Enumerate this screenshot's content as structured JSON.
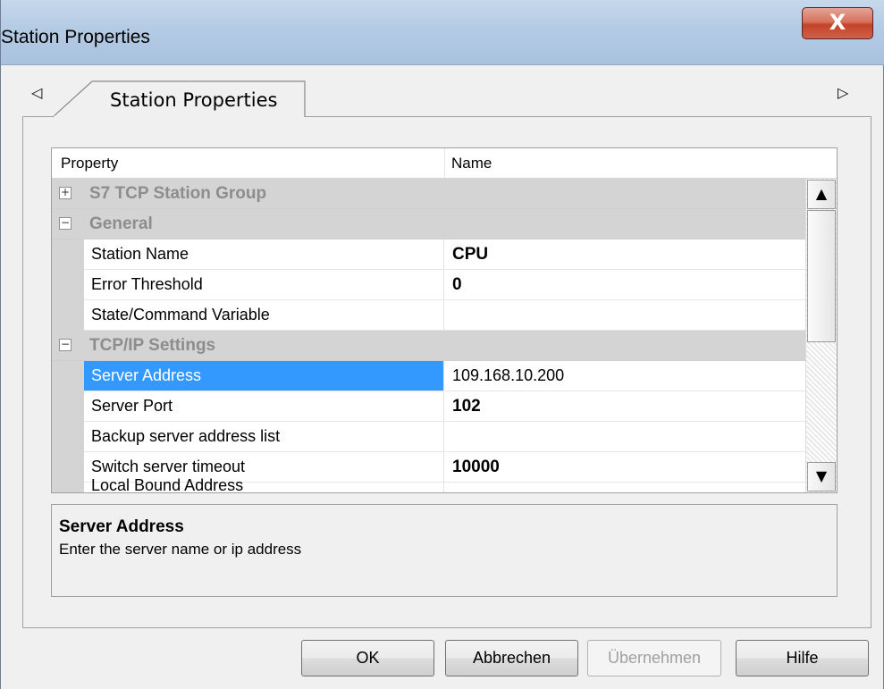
{
  "window": {
    "title": "Station Properties",
    "close_glyph": "X"
  },
  "tabs": {
    "prev_arrow": "◁",
    "next_arrow": "▷",
    "items": [
      {
        "label": "Station Properties",
        "active": true
      }
    ]
  },
  "grid": {
    "header": {
      "property": "Property",
      "name": "Name"
    },
    "rows": [
      {
        "type": "category",
        "expander": "+",
        "label": "S7 TCP Station Group"
      },
      {
        "type": "category",
        "expander": "−",
        "label": "General"
      },
      {
        "type": "property",
        "name": "Station Name",
        "value": "CPU",
        "bold": true
      },
      {
        "type": "property",
        "name": "Error Threshold",
        "value": "0",
        "bold": true
      },
      {
        "type": "property",
        "name": "State/Command Variable",
        "value": ""
      },
      {
        "type": "category",
        "expander": "−",
        "label": "TCP/IP Settings"
      },
      {
        "type": "property",
        "name": "Server Address",
        "value": "109.168.10.200",
        "selected": true
      },
      {
        "type": "property",
        "name": "Server Port",
        "value": "102",
        "bold": true
      },
      {
        "type": "property",
        "name": "Backup server address list",
        "value": ""
      },
      {
        "type": "property",
        "name": "Switch server timeout",
        "value": "10000",
        "bold": true
      },
      {
        "type": "property",
        "name": "Local Bound Address",
        "value": ""
      }
    ],
    "scroll_up": "▲",
    "scroll_down": "▼"
  },
  "description": {
    "title": "Server Address",
    "text": "Enter the server name or ip address"
  },
  "buttons": {
    "ok": "OK",
    "cancel": "Abbrechen",
    "apply": "Übernehmen",
    "help": "Hilfe"
  },
  "colors": {
    "selection": "#3399ff",
    "category_bg": "#d4d4d4",
    "category_text": "#8d8d8d",
    "close_button": "#c3432a"
  }
}
